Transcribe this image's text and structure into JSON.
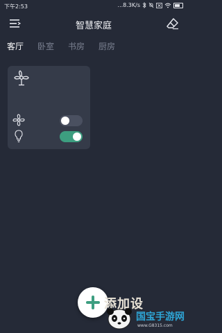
{
  "status_bar": {
    "time": "下午2:53",
    "network_speed": "...8.3K/s",
    "icons": [
      "bluetooth-icon",
      "mute-icon",
      "x-icon",
      "wifi-icon",
      "battery-icon"
    ]
  },
  "header": {
    "title": "智慧家庭",
    "menu_icon": "menu-icon",
    "action_icon": "eraser-icon"
  },
  "tabs": [
    {
      "label": "客厅",
      "active": true
    },
    {
      "label": "卧室",
      "active": false
    },
    {
      "label": "书房",
      "active": false
    },
    {
      "label": "厨房",
      "active": false
    }
  ],
  "room_card": {
    "header_icon": "ceiling-fan-icon",
    "devices": [
      {
        "icon": "fan-icon",
        "on": false
      },
      {
        "icon": "light-bulb-icon",
        "on": true
      }
    ]
  },
  "fab": {
    "icon": "plus-icon",
    "label": "添加设"
  },
  "watermark": {
    "logo_text": "国宝手游网",
    "url": "www.G8315.com"
  },
  "colors": {
    "background": "#252a37",
    "card": "#353b49",
    "accent": "#3d9e80",
    "tab_inactive": "#7a8090"
  }
}
